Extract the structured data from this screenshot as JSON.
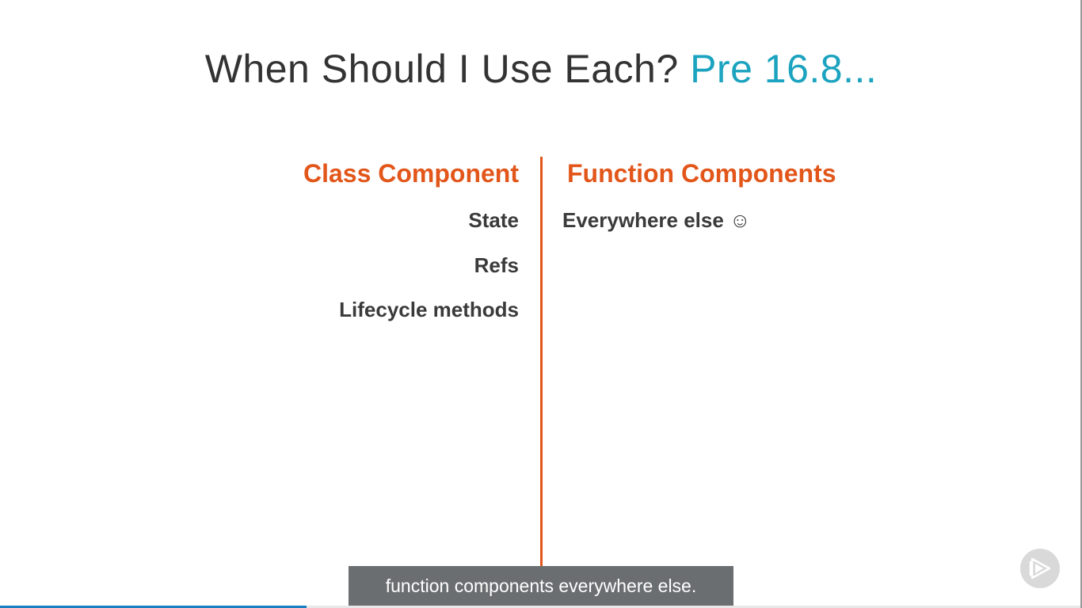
{
  "slide": {
    "title_main": "When Should I Use Each?",
    "title_accent": "Pre 16.8...",
    "left_column": {
      "heading": "Class Component",
      "items": [
        "State",
        "Refs",
        "Lifecycle methods"
      ]
    },
    "right_column": {
      "heading": "Function Components",
      "items": [
        "Everywhere else ☺"
      ]
    }
  },
  "player": {
    "caption": "function components everywhere else.",
    "progress": 0.283,
    "logo_icon": "pluralsight-play-icon"
  },
  "colors": {
    "accent_teal": "#1ba3bf",
    "accent_orange": "#e2561a",
    "progress_blue": "#1a7fc1",
    "caption_bg": "#6b6e71"
  }
}
